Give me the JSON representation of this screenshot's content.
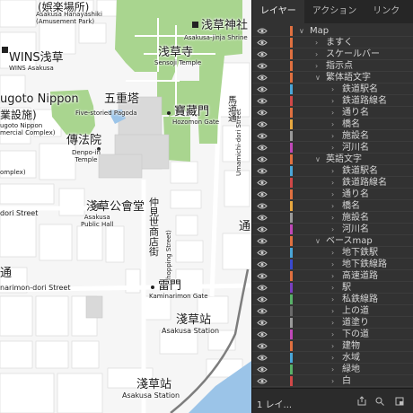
{
  "panel": {
    "tabs": [
      {
        "label": "レイヤー"
      },
      {
        "label": "アクション"
      },
      {
        "label": "リンク"
      }
    ],
    "layer_count": "1 レイ...",
    "layers": [
      {
        "name": "Map",
        "expanded": true,
        "color": "#e07040"
      },
      {
        "name": "ますく",
        "expanded": false,
        "color": "#e07040"
      },
      {
        "name": "スケールバー",
        "expanded": false,
        "color": "#e07040"
      },
      {
        "name": "指示点",
        "expanded": false,
        "color": "#e07040"
      },
      {
        "name": "繁体語文字",
        "expanded": true,
        "color": "#e07040"
      },
      {
        "name": "鉄道駅名",
        "expanded": false,
        "color": "#4aa6d8"
      },
      {
        "name": "鉄道路線名",
        "expanded": false,
        "color": "#d04848"
      },
      {
        "name": "通り名",
        "expanded": false,
        "color": "#e07040"
      },
      {
        "name": "橋名",
        "expanded": false,
        "color": "#e8a840"
      },
      {
        "name": "施設名",
        "expanded": false,
        "color": "#9a9a9a"
      },
      {
        "name": "河川名",
        "expanded": false,
        "color": "#c048b8"
      },
      {
        "name": "英語文字",
        "expanded": true,
        "color": "#e07040"
      },
      {
        "name": "鉄道駅名",
        "expanded": false,
        "color": "#4aa6d8"
      },
      {
        "name": "鉄道路線名",
        "expanded": false,
        "color": "#d04848"
      },
      {
        "name": "通り名",
        "expanded": false,
        "color": "#e07040"
      },
      {
        "name": "橋名",
        "expanded": false,
        "color": "#e8a840"
      },
      {
        "name": "施設名",
        "expanded": false,
        "color": "#9a9a9a"
      },
      {
        "name": "河川名",
        "expanded": false,
        "color": "#c048b8"
      },
      {
        "name": "ベースmap",
        "expanded": true,
        "color": "#e07040"
      },
      {
        "name": "地下鉄駅",
        "expanded": false,
        "color": "#4aa6d8"
      },
      {
        "name": "地下鉄線路",
        "expanded": false,
        "color": "#3a4ad0"
      },
      {
        "name": "高速道路",
        "expanded": false,
        "color": "#e07040"
      },
      {
        "name": "駅",
        "expanded": false,
        "color": "#7a40c0"
      },
      {
        "name": "私鉄線路",
        "expanded": false,
        "color": "#58b068"
      },
      {
        "name": "上の道",
        "expanded": false,
        "color": "#6a6a6a"
      },
      {
        "name": "道塗り",
        "expanded": false,
        "color": "#9a9a9a"
      },
      {
        "name": "下の道",
        "expanded": false,
        "color": "#c048b8"
      },
      {
        "name": "建物",
        "expanded": false,
        "color": "#e07040"
      },
      {
        "name": "水域",
        "expanded": false,
        "color": "#4aa6d8"
      },
      {
        "name": "緑地",
        "expanded": false,
        "color": "#58b068"
      },
      {
        "name": "白",
        "expanded": false,
        "color": "#d04848"
      }
    ]
  },
  "map": {
    "labels": {
      "hanayashiki_jp": "(娯楽場所)",
      "hanayashiki_en": "Asakusa Hanayashiki\n(Amusement Park)",
      "jinja_jp": "浅草神社",
      "jinja_en": "Asakusa-jinja Shrine",
      "wins_jp": "WINS浅草",
      "wins_en": "WINS Asakusa",
      "senso_jp": "浅草寺",
      "senso_en": "Sensoji Temple",
      "rokugo_jp": "ugoto Nippon",
      "rokugo_jp2": "業設施)",
      "rokugo_en": "ugoto Nippon\nmercial Complex)",
      "pagoda_jp": "五重塔",
      "pagoda_en": "Five-storied Pagoda",
      "hozo_jp": "寶藏門",
      "hozo_en": "Hozomon Gate",
      "umamichi_jp": "馬道通",
      "umamichi_en": "Umamichi-dori Street",
      "denpo_jp": "傳法院",
      "denpo_en": "Denpo-in\nTemple",
      "complex_en": "omplex)",
      "odori_en": "dori Street",
      "kokaido_jp": "淺草公會堂",
      "kokaido_en": "Asakusa\nPublic Hall",
      "nakamise_jp": "仲見世商店街",
      "nakamise_en": "(Shopping Street)",
      "dori_jp": "通",
      "kaminarimon_dori_en": "narimon-dori Street",
      "kaminarimon_jp": "雷門",
      "kaminarimon_en": "Kaminarimon Gate",
      "station1_jp": "淺草站",
      "station1_en": "Asakusa Station",
      "station2_jp": "淺草站",
      "station2_en": "Asakusa Station",
      "right_edge_jp": "通"
    }
  }
}
